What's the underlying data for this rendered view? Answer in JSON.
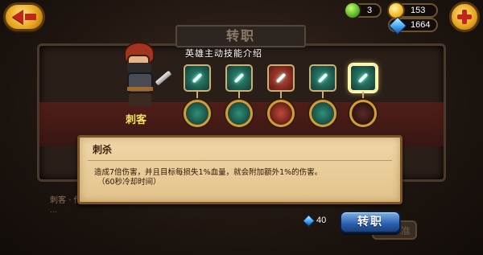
{
  "resources": {
    "leaf_count": "3",
    "gold": "153",
    "gems": "1664"
  },
  "panel": {
    "title": "转职",
    "skills_heading": "英雄主动技能介绍"
  },
  "hero": {
    "name": "刺客"
  },
  "skills": [
    {
      "name": "skill-slot-1",
      "color": "teal"
    },
    {
      "name": "skill-slot-2",
      "color": "teal"
    },
    {
      "name": "skill-slot-3",
      "color": "red"
    },
    {
      "name": "skill-slot-4",
      "color": "teal"
    },
    {
      "name": "skill-slot-5",
      "color": "teal",
      "selected": true
    }
  ],
  "tooltip": {
    "title": "刺杀",
    "description": "造成7倍伤害，并且目标每损失1%血量，就会附加额外1%的伤害。",
    "cooldown": "（60秒冷却时间）"
  },
  "lore": {
    "title": "刺客 · 传说",
    "line1": "..."
  },
  "action": {
    "cost": "40",
    "convert_label": "转职",
    "under_label": "准"
  }
}
